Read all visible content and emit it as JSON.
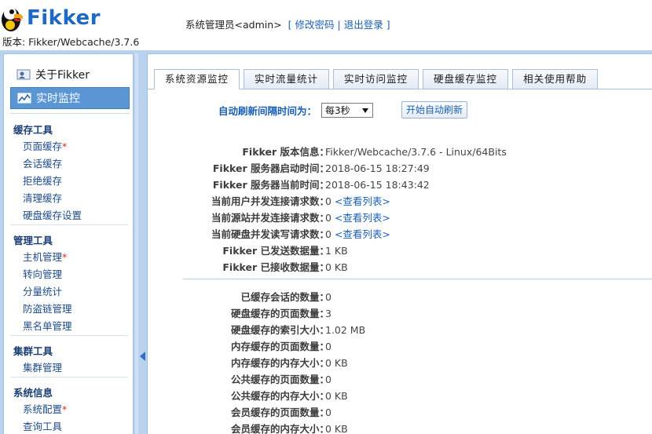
{
  "header": {
    "logo_text": "Fikker",
    "version": "版本: Fikker/Webcache/3.7.6",
    "user_label": "系统管理员<admin>",
    "bracket_open": "[",
    "change_password": "修改密码",
    "divider": "|",
    "logout": "退出登录",
    "bracket_close": "]"
  },
  "sidebar": {
    "top_items": [
      {
        "label": "关于Fikker",
        "icon": "user-card-icon"
      },
      {
        "label": "实时监控",
        "icon": "monitor-chart-icon"
      }
    ],
    "sections": [
      {
        "title": "缓存工具",
        "items": [
          {
            "label": "页面缓存",
            "star": "*"
          },
          {
            "label": "会话缓存",
            "star": ""
          },
          {
            "label": "拒绝缓存",
            "star": ""
          },
          {
            "label": "清理缓存",
            "star": ""
          },
          {
            "label": "硬盘缓存设置",
            "star": ""
          }
        ]
      },
      {
        "title": "管理工具",
        "items": [
          {
            "label": "主机管理",
            "star": "*"
          },
          {
            "label": "转向管理",
            "star": ""
          },
          {
            "label": "分量统计",
            "star": ""
          },
          {
            "label": "防盗链管理",
            "star": ""
          },
          {
            "label": "黑名单管理",
            "star": ""
          }
        ]
      },
      {
        "title": "集群工具",
        "items": [
          {
            "label": "集群管理",
            "star": ""
          }
        ]
      },
      {
        "title": "系统信息",
        "items": [
          {
            "label": "系统配置",
            "star": "*"
          },
          {
            "label": "查询工具",
            "star": ""
          }
        ]
      }
    ]
  },
  "tabs": [
    "系统资源监控",
    "实时流量统计",
    "实时访问监控",
    "硬盘缓存监控",
    "相关使用帮助"
  ],
  "refresh": {
    "label": "自动刷新间隔时间为：",
    "selected": "每3秒",
    "button": "开始自动刷新"
  },
  "info_top": [
    {
      "label": "Fikker 版本信息：",
      "value": "Fikker/Webcache/3.7.6 - Linux/64Bits",
      "link": ""
    },
    {
      "label": "Fikker 服务器启动时间：",
      "value": "2018-06-15 18:27:49",
      "link": ""
    },
    {
      "label": "Fikker 服务器当前时间：",
      "value": "2018-06-15 18:43:42",
      "link": ""
    },
    {
      "label": "当前用户并发连接请求数：",
      "value": "0",
      "link": "<查看列表>"
    },
    {
      "label": "当前源站并发连接请求数：",
      "value": "0",
      "link": "<查看列表>"
    },
    {
      "label": "当前硬盘并发读写请求数：",
      "value": "0",
      "link": "<查看列表>"
    },
    {
      "label": "Fikker 已发送数据量：",
      "value": "1 KB",
      "link": ""
    },
    {
      "label": "Fikker 已接收数据量：",
      "value": "0 KB",
      "link": ""
    }
  ],
  "info_bottom": [
    {
      "label": "已缓存会话的数量：",
      "value": "0"
    },
    {
      "label": "硬盘缓存的页面数量：",
      "value": "3"
    },
    {
      "label": "硬盘缓存的索引大小：",
      "value": "1.02 MB"
    },
    {
      "label": "内存缓存的页面数量：",
      "value": "0"
    },
    {
      "label": "内存缓存的内存大小：",
      "value": "0 KB"
    },
    {
      "label": "公共缓存的页面数量：",
      "value": "0"
    },
    {
      "label": "公共缓存的内存大小：",
      "value": "0 KB"
    },
    {
      "label": "会员缓存的页面数量：",
      "value": "0"
    },
    {
      "label": "会员缓存的内存大小：",
      "value": "0 KB"
    }
  ],
  "colors": {
    "brand_blue": "#1d69c4",
    "link_blue": "#1a5fb4",
    "frame_blue": "#b9d3ef",
    "active_nav": "#5b96d4",
    "required_star": "#d9261c"
  }
}
